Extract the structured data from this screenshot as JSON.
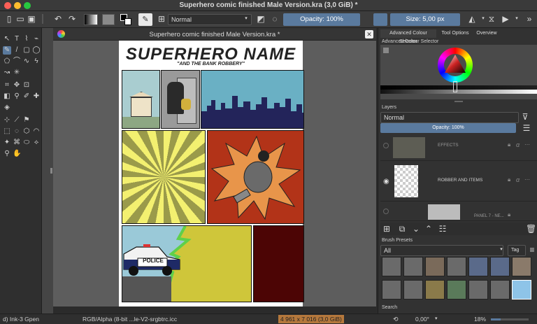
{
  "window": {
    "title": "Superhero comic finished Male Version.kra (3,0 GiB)  *"
  },
  "toolbar": {
    "blend_mode": "Normal",
    "opacity": "Opacity: 100%",
    "size": "Size: 5,00 px"
  },
  "document": {
    "tab_title": "Superhero comic finished Male Version.kra *"
  },
  "comic": {
    "title": "SUPERHERO NAME",
    "subtitle": "\"AND THE BANK ROBBERY\"",
    "police_label": "POLICE"
  },
  "right_panel": {
    "tabs": [
      "Advanced Colour Selector",
      "Tool Options",
      "Overview"
    ],
    "color_selector_header": "Advanced Colour Selector",
    "layers_header": "Layers",
    "layers_blend": "Normal",
    "layers_opacity": "Opacity:  100%",
    "layers": [
      {
        "name": "EFFECTS"
      },
      {
        "name": "ROBBER AND ITEMS"
      },
      {
        "name": "PANEL 7 - NE..."
      }
    ],
    "brush_presets_header": "Brush Presets",
    "brush_filter": "All",
    "tag_label": "Tag",
    "search_label": "Search"
  },
  "statusbar": {
    "brush": "d) Ink-3 Gpen",
    "color_profile": "RGB/Alpha (8-bit ...le-V2-srgbtrc.icc",
    "image_size": "4 961 x 7 016 (3,0 GiB)",
    "rotation": "0,00°",
    "zoom": "18%"
  },
  "colors": {
    "accent": "#5a7a9e",
    "bg": "#2b2b2b",
    "size_badge": "#b5783c"
  }
}
